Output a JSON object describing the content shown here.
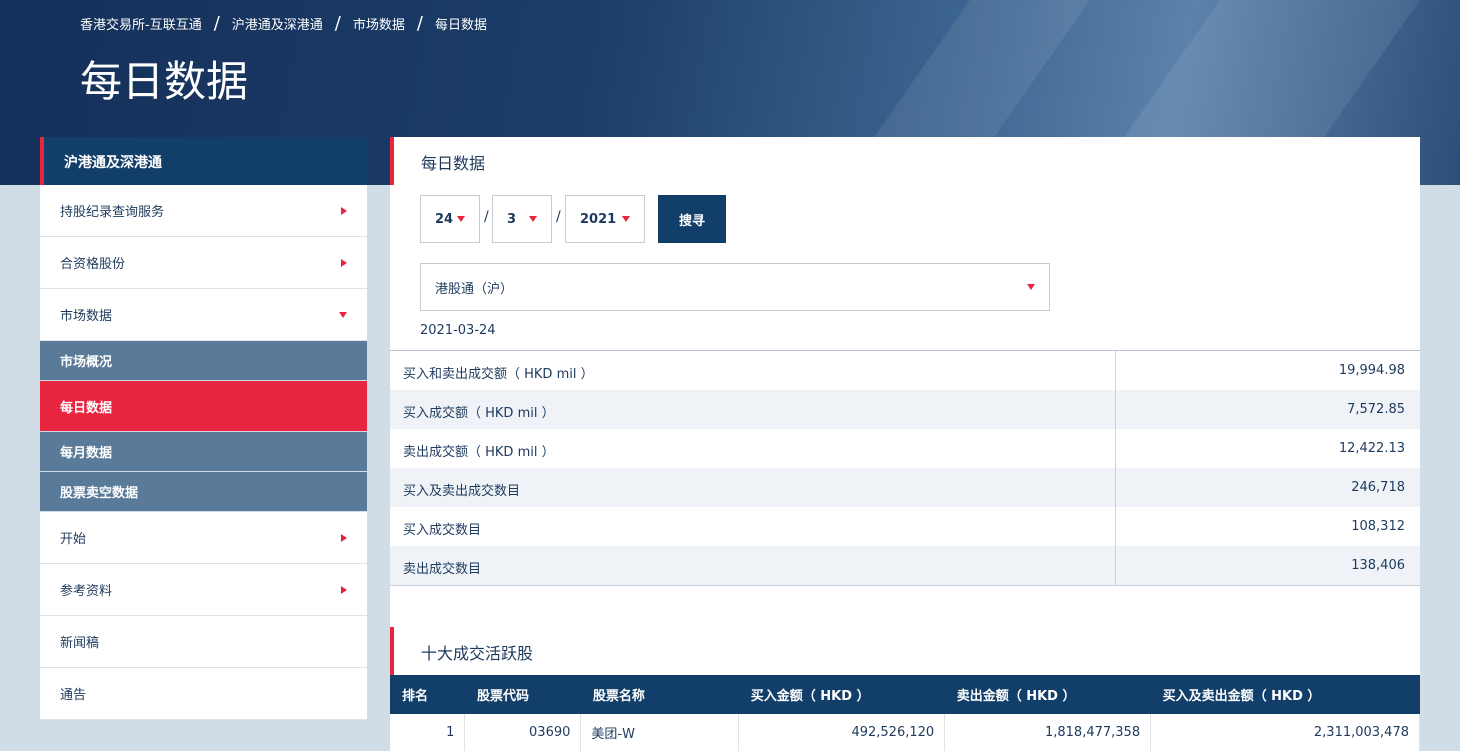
{
  "breadcrumb": [
    "香港交易所-互联互通",
    "沪港通及深港通",
    "市场数据",
    "每日数据"
  ],
  "page_title": "每日数据",
  "sidebar": {
    "header": "沪港通及深港通",
    "items": [
      {
        "label": "持股纪录查询服务",
        "type": "item",
        "arrow": "right"
      },
      {
        "label": "合资格股份",
        "type": "item",
        "arrow": "right"
      },
      {
        "label": "市场数据",
        "type": "item",
        "arrow": "down"
      },
      {
        "label": "市场概况",
        "type": "sub"
      },
      {
        "label": "每日数据",
        "type": "sub",
        "active": true
      },
      {
        "label": "每月数据",
        "type": "sub"
      },
      {
        "label": "股票卖空数据",
        "type": "sub"
      },
      {
        "label": "开始",
        "type": "item",
        "arrow": "right"
      },
      {
        "label": "参考资料",
        "type": "item",
        "arrow": "right"
      },
      {
        "label": "新闻稿",
        "type": "item"
      },
      {
        "label": "通告",
        "type": "item"
      }
    ]
  },
  "main": {
    "title": "每日数据",
    "day": "24",
    "month": "3",
    "year": "2021",
    "search_label": "搜寻",
    "market": "港股通（沪）",
    "date": "2021-03-24",
    "stats": [
      {
        "label": "买入和卖出成交额（ HKD mil ）",
        "value": "19,994.98"
      },
      {
        "label": "买入成交额（ HKD mil ）",
        "value": "7,572.85"
      },
      {
        "label": "卖出成交额（ HKD mil ）",
        "value": "12,422.13"
      },
      {
        "label": "买入及卖出成交数目",
        "value": "246,718"
      },
      {
        "label": "买入成交数目",
        "value": "108,312"
      },
      {
        "label": "卖出成交数目",
        "value": "138,406"
      }
    ],
    "top10_title": "十大成交活跃股",
    "top10_headers": [
      "排名",
      "股票代码",
      "股票名称",
      "买入金额（ HKD ）",
      "卖出金额（ HKD ）",
      "买入及卖出金额（ HKD ）"
    ],
    "top10_rows": [
      [
        "1",
        "03690",
        "美团-W",
        "492,526,120",
        "1,818,477,358",
        "2,311,003,478"
      ]
    ]
  },
  "colors": {
    "navy": "#123e6a",
    "accent": "#e8253f"
  }
}
